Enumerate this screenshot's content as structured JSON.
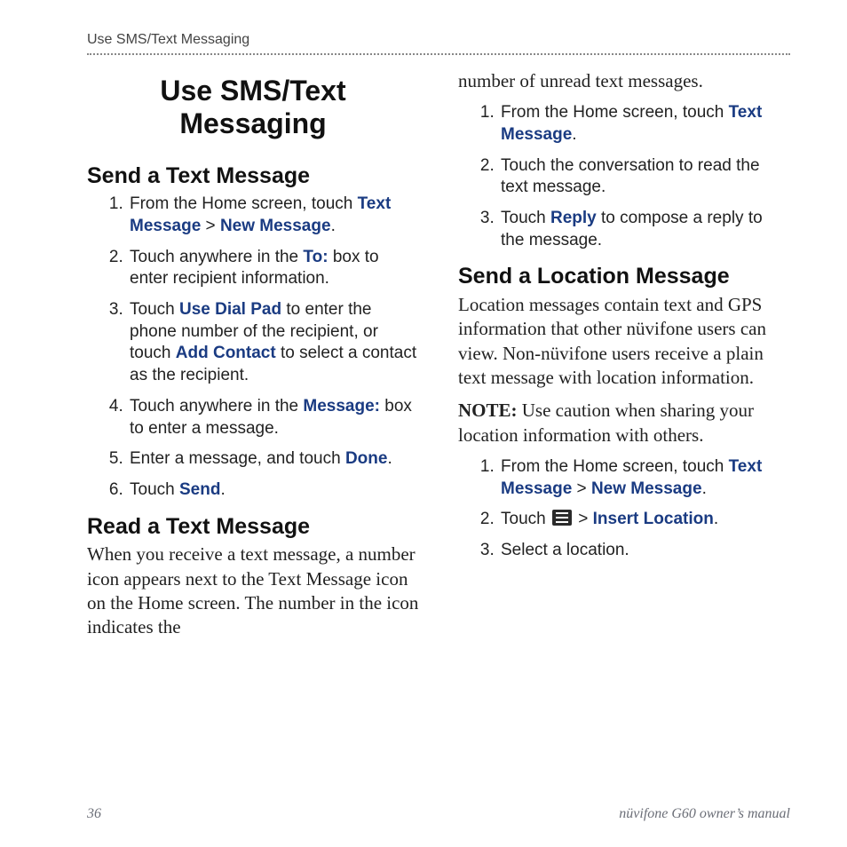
{
  "header": {
    "running": "Use SMS/Text Messaging"
  },
  "title": "Use SMS/Text Messaging",
  "left": {
    "section1": {
      "heading": "Send a Text Message",
      "steps": [
        {
          "pre": "From the Home screen, touch ",
          "kw1": "Text Message",
          "chev": " > ",
          "kw2": "New Message",
          "post": "."
        },
        {
          "pre": "Touch anywhere in the ",
          "kw1": "To:",
          "post": " box to enter recipient information."
        },
        {
          "pre": "Touch ",
          "kw1": "Use Dial Pad",
          "mid": " to enter the phone number of the recipient, or touch ",
          "kw2": "Add Contact",
          "post": " to select a contact as the recipient."
        },
        {
          "pre": "Touch anywhere in the ",
          "kw1": "Message:",
          "post": " box to enter a message."
        },
        {
          "pre": "Enter a message, and touch ",
          "kw1": "Done",
          "post": "."
        },
        {
          "pre": "Touch ",
          "kw1": "Send",
          "post": "."
        }
      ]
    },
    "section2": {
      "heading": "Read a Text Message",
      "intro": "When you receive a text message, a number icon appears next to the Text Message icon on the Home screen. The number in the icon indicates the"
    }
  },
  "right": {
    "continuation": "number of unread text messages.",
    "steps_read": [
      {
        "pre": "From the Home screen, touch ",
        "kw1": "Text Message",
        "post": "."
      },
      {
        "pre": "Touch the conversation to read the text message."
      },
      {
        "pre": "Touch ",
        "kw1": "Reply",
        "post": " to compose a reply to the message."
      }
    ],
    "section3": {
      "heading": "Send a Location Message",
      "intro": "Location messages contain text and GPS information that other nüvifone users can view. Non-nüvifone users receive a plain text message with location information.",
      "note_label": "NOTE:",
      "note_body": " Use caution when sharing your location information with others.",
      "steps": [
        {
          "pre": "From the Home screen, touch ",
          "kw1": "Text Message",
          "chev": " > ",
          "kw2": "New Message",
          "post": "."
        },
        {
          "pre": "Touch ",
          "icon": true,
          "chev": " > ",
          "kw2": "Insert Location",
          "post": "."
        },
        {
          "pre": "Select a location."
        }
      ]
    }
  },
  "footer": {
    "page": "36",
    "manual": "nüvifone G60 owner’s manual"
  }
}
